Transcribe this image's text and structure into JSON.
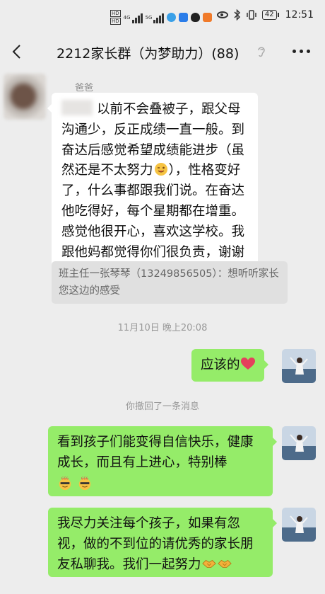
{
  "status_bar": {
    "hd1": "HD",
    "hd2": "HD",
    "gen1": "4G",
    "gen2": "5G",
    "battery": "42",
    "time": "12:51"
  },
  "nav": {
    "title": "2212家长群（为梦助力）(88)"
  },
  "messages": {
    "sender_name": "爸爸",
    "parent_text_a": "以前不会叠被子，跟父母沟通少，反正成绩一直一般。到奋达后感觉希望成绩能进步（虽然还是不太努力",
    "parent_text_b": "），性格变好了，什么事都跟我们说。在奋达他吃得好，每个星期都在增重。感觉他很开心，喜欢这学校。我跟他妈都觉得你们很负责，谢谢",
    "quote_text": "班主任一张琴琴（13249856505）：想听听家长您这边的感受",
    "timestamp": "11月10日 晚上20:08",
    "reply1": "应该的",
    "recall_notice": "你撤回了一条消息",
    "reply2": "看到孩子们能变得自信快乐，健康成长，而且有上进心，特别棒",
    "reply3": "我尽力关注每个孩子，如果有忽视，做的不到位的请优秀的家长朋友私聊我。我们一起努力"
  },
  "colors": {
    "background": "#ededed",
    "bubble_self": "#95ec69",
    "bubble_other": "#ffffff",
    "quote_bg": "#e0e0e0"
  },
  "icons": [
    "back-arrow-icon",
    "ear-icon",
    "more-icon",
    "eye-icon",
    "bluetooth-icon",
    "vibrate-icon",
    "battery-icon",
    "heart-emoji-icon",
    "wink-emoji-icon",
    "grin-emoji-icon",
    "666-emoji-icon",
    "handshake-emoji-icon"
  ]
}
